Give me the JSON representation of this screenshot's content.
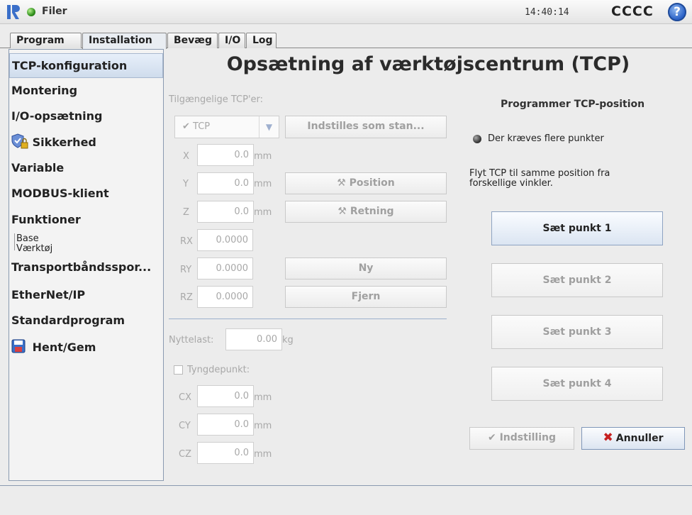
{
  "titlebar": {
    "app_title": "Filer",
    "clock": "14:40:14",
    "robot_name": "CCCC",
    "help_label": "?"
  },
  "tabs": [
    {
      "label": "Program"
    },
    {
      "label": "Installation"
    },
    {
      "label": "Bevæg"
    },
    {
      "label": "I/O"
    },
    {
      "label": "Log"
    }
  ],
  "sidebar": {
    "items": [
      {
        "label": "TCP-konfiguration"
      },
      {
        "label": "Montering"
      },
      {
        "label": "I/O-opsætning"
      },
      {
        "label": "Sikkerhed"
      },
      {
        "label": "Variable"
      },
      {
        "label": "MODBUS-klient"
      },
      {
        "label": "Funktioner"
      },
      {
        "label": "Transportbåndsspor..."
      },
      {
        "label": "EtherNet/IP"
      },
      {
        "label": "Standardprogram"
      },
      {
        "label": "Hent/Gem"
      }
    ],
    "sub_items": [
      {
        "label": "Base"
      },
      {
        "label": "Værktøj"
      }
    ]
  },
  "main": {
    "title": "Opsætning af værktøjscentrum (TCP)",
    "available_label": "Tilgængelige TCP'er:",
    "tcp_select": "TCP",
    "set_default_label": "Indstilles som stan...",
    "fields": {
      "x": {
        "label": "X",
        "value": "0.0",
        "unit": "mm"
      },
      "y": {
        "label": "Y",
        "value": "0.0",
        "unit": "mm"
      },
      "z": {
        "label": "Z",
        "value": "0.0",
        "unit": "mm"
      },
      "rx": {
        "label": "RX",
        "value": "0.0000"
      },
      "ry": {
        "label": "RY",
        "value": "0.0000"
      },
      "rz": {
        "label": "RZ",
        "value": "0.0000"
      }
    },
    "position_label": "Position",
    "direction_label": "Retning",
    "new_label": "Ny",
    "remove_label": "Fjern",
    "payload": {
      "label": "Nyttelast:",
      "value": "0.00",
      "unit": "kg"
    },
    "cog_label": "Tyngdepunkt:",
    "cog": {
      "cx": {
        "label": "CX",
        "value": "0.0",
        "unit": "mm"
      },
      "cy": {
        "label": "CY",
        "value": "0.0",
        "unit": "mm"
      },
      "cz": {
        "label": "CZ",
        "value": "0.0",
        "unit": "mm"
      }
    }
  },
  "right_panel": {
    "title": "Programmer TCP-position",
    "status": "Der kræves flere punkter",
    "instruction": "Flyt TCP til samme position fra forskellige vinkler.",
    "points": [
      {
        "label": "Sæt punkt 1"
      },
      {
        "label": "Sæt punkt 2"
      },
      {
        "label": "Sæt punkt 3"
      },
      {
        "label": "Sæt punkt 4"
      }
    ],
    "setting_label": "Indstilling",
    "cancel_label": "Annuller"
  },
  "colors": {
    "accent": "#2b62c7",
    "status_green": "#2f8f1c",
    "cancel_red": "#c62020"
  }
}
